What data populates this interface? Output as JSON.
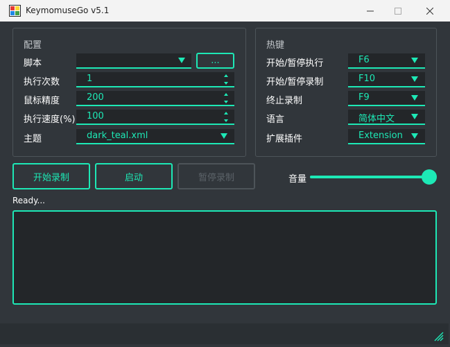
{
  "window": {
    "title": "KeymomuseGo v5.1",
    "icon": "app-logo-icon"
  },
  "colors": {
    "accent": "#1de9b6",
    "background": "#31363b",
    "field_background": "#232629",
    "border": "#4d5459",
    "disabled_text": "#5c6369"
  },
  "config": {
    "title": "配置",
    "script_label": "脚本",
    "script_value": "",
    "browse_label": "...",
    "exec_count_label": "执行次数",
    "exec_count_value": "1",
    "mouse_precision_label": "鼠标精度",
    "mouse_precision_value": "200",
    "exec_speed_label": "执行速度(%)",
    "exec_speed_value": "100",
    "theme_label": "主题",
    "theme_value": "dark_teal.xml"
  },
  "hotkeys": {
    "title": "热键",
    "start_pause_exec_label": "开始/暂停执行",
    "start_pause_exec_value": "F6",
    "start_pause_record_label": "开始/暂停录制",
    "start_pause_record_value": "F10",
    "stop_record_label": "终止录制",
    "stop_record_value": "F9",
    "language_label": "语言",
    "language_value": "简体中文",
    "plugin_label": "扩展插件",
    "plugin_value": "Extension"
  },
  "actions": {
    "start_record": "开始录制",
    "launch": "启动",
    "pause_record": "暂停录制"
  },
  "volume": {
    "label": "音量",
    "value": 1.0
  },
  "status": {
    "text": "Ready..."
  },
  "log": {
    "text": ""
  }
}
